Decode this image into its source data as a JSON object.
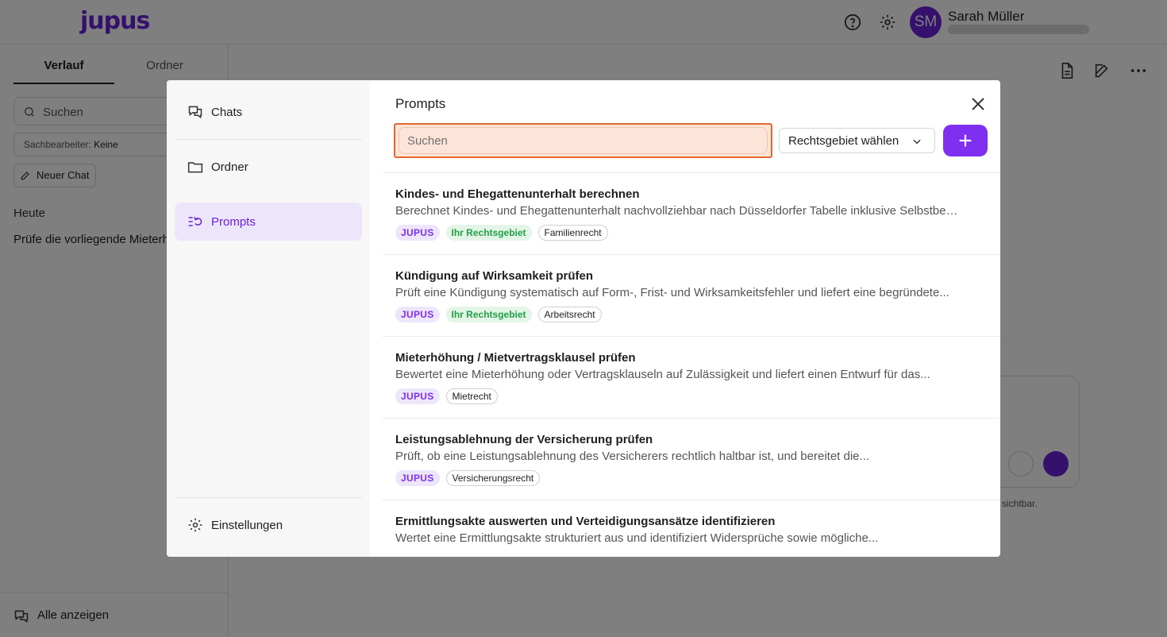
{
  "app": {
    "logo": "jupus",
    "user": {
      "initials": "SM",
      "name": "Sarah Müller"
    }
  },
  "sidebar": {
    "tabs": [
      "Verlauf",
      "Ordner"
    ],
    "search_placeholder": "Suchen",
    "filter_label": "Sachbearbeiter:",
    "filter_value": "Keine",
    "new_chat": "Neuer Chat",
    "section": "Heute",
    "chat_item": "Prüfe die vorliegende Mieterhöhung",
    "show_all": "Alle anzeigen"
  },
  "main": {
    "footer_text": "sichtbar."
  },
  "modal": {
    "nav": {
      "chats": "Chats",
      "folders": "Ordner",
      "prompts": "Prompts",
      "settings": "Einstellungen"
    },
    "title": "Prompts",
    "search_placeholder": "Suchen",
    "area_select": "Rechtsgebiet wählen",
    "prompts": [
      {
        "title": "Kindes- und Ehegattenunterhalt berechnen",
        "description": "Berechnet Kindes- und Ehegattenunterhalt nachvollziehbar nach Düsseldorfer Tabelle inklusive Selbstbehalt und Bedarfsberechnung",
        "tags": [
          {
            "label": "JUPUS",
            "kind": "jupus"
          },
          {
            "label": "Ihr Rechtsgebiet",
            "kind": "green"
          },
          {
            "label": "Familienrecht",
            "kind": "area"
          }
        ]
      },
      {
        "title": "Kündigung auf Wirksamkeit prüfen",
        "description": "Prüft eine Kündigung systematisch auf Form-, Frist- und Wirksamkeitsfehler und liefert eine begründete...",
        "tags": [
          {
            "label": "JUPUS",
            "kind": "jupus"
          },
          {
            "label": "Ihr Rechtsgebiet",
            "kind": "green"
          },
          {
            "label": "Arbeitsrecht",
            "kind": "area"
          }
        ]
      },
      {
        "title": "Mieterhöhung / Mietvertragsklausel prüfen",
        "description": "Bewertet eine Mieterhöhung oder Vertragsklauseln auf Zulässigkeit und liefert einen Entwurf für das...",
        "tags": [
          {
            "label": "JUPUS",
            "kind": "jupus"
          },
          {
            "label": "Mietrecht",
            "kind": "area"
          }
        ]
      },
      {
        "title": "Leistungsablehnung der Versicherung prüfen",
        "description": "Prüft, ob eine Leistungsablehnung des Versicherers rechtlich haltbar ist, und bereitet die...",
        "tags": [
          {
            "label": "JUPUS",
            "kind": "jupus"
          },
          {
            "label": "Versicherungsrecht",
            "kind": "area"
          }
        ]
      },
      {
        "title": "Ermittlungsakte auswerten und Verteidigungsansätze identifizieren",
        "description": "Wertet eine Ermittlungsakte strukturiert aus und identifiziert Widersprüche sowie mögliche...",
        "tags": []
      }
    ]
  },
  "colors": {
    "brand": "#6b21d9",
    "accent": "#7e2ff0",
    "search_focus_border": "#e0682c",
    "search_focus_bg": "#fde4d9"
  }
}
